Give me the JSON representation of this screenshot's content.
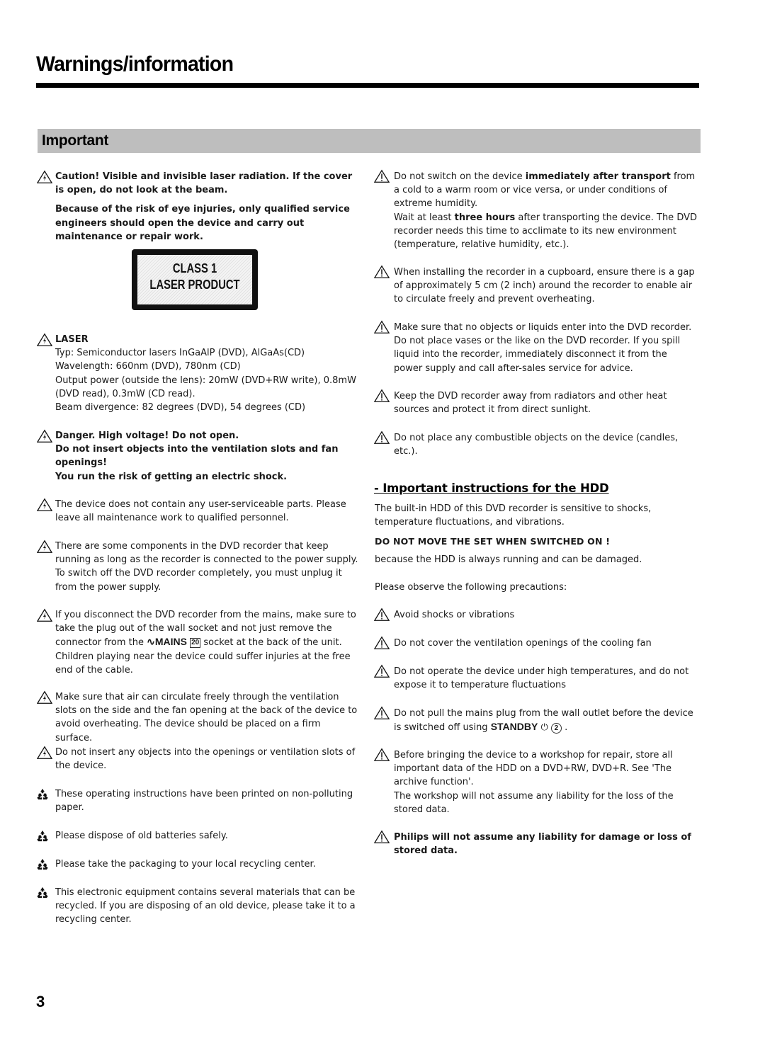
{
  "page": {
    "title": "Warnings/information",
    "section_title": "Important",
    "page_number": "3"
  },
  "left": {
    "caution": {
      "line1": "Caution! Visible and invisible laser radiation. If the cover is open, do not look at the beam.",
      "line2": "Because of the risk of eye injuries, only qualified service engineers should open the device and carry out maintenance or repair work."
    },
    "laser_label": {
      "line1": "CLASS 1",
      "line2": "LASER PRODUCT"
    },
    "laser": {
      "heading": "LASER",
      "lines": [
        "Typ: Semiconductor lasers InGaAlP (DVD), AlGaAs(CD)",
        "Wavelength: 660nm (DVD), 780nm (CD)",
        "Output power (outside the lens): 20mW (DVD+RW write), 0.8mW (DVD read), 0.3mW (CD read).",
        "Beam divergence: 82 degrees (DVD), 54 degrees (CD)"
      ]
    },
    "danger": {
      "line1": "Danger. High voltage! Do not open.",
      "line2": "Do not insert objects into the ventilation slots and fan openings!",
      "line3": "You run the risk of getting an electric shock."
    },
    "no_user_parts": "The device does not contain any user-serviceable parts. Please leave all maintenance work to qualified personnel.",
    "components_running": "There are some components in the DVD recorder that keep running as long as the recorder is connected to the power supply. To switch off the DVD recorder completely, you must unplug it from the power supply.",
    "disconnect": {
      "before": "If you disconnect the DVD recorder from the mains, make sure to take the plug out of the wall socket and not just remove the connector from the",
      "mains_symbol": "∿",
      "mains_label": "MAINS",
      "mains_number": "20",
      "after": "socket at the back of the unit. Children playing near the device could suffer injuries at the free end of the cable."
    },
    "air_circulate": "Make sure that air can circulate freely through the ventilation slots on the side and the fan opening at the back of the device to avoid overheating. The device should be placed on a firm surface.",
    "no_insert": "Do not insert any objects into the openings or ventilation slots of the device.",
    "recycle_items": [
      "These operating instructions have been printed on non-polluting paper.",
      "Please dispose of old batteries safely.",
      "Please take the packaging to your local recycling center.",
      "This electronic equipment contains several materials that can be recycled. If you are disposing of an old device, please take it to a recycling center."
    ]
  },
  "right": {
    "transport": {
      "pre": "Do not switch on the device ",
      "bold": "immediately after transport",
      "post": " from a cold to a warm room or vice versa, or under conditions of extreme humidity.",
      "wait_pre": "Wait at least ",
      "wait_bold": "three hours",
      "wait_post": " after transporting the device. The DVD recorder needs this time to acclimate to its new environment (temperature, relative humidity, etc.)."
    },
    "cupboard": "When installing the recorder in a cupboard, ensure there is a gap of approximately 5 cm (2 inch) around the recorder to enable air to circulate freely and prevent overheating.",
    "liquids": "Make sure that no objects or liquids enter into the DVD recorder. Do not place vases or the like on the DVD recorder. If you spill liquid into the recorder, immediately disconnect it from the power supply and call after-sales service for advice.",
    "radiators": "Keep the DVD recorder away from radiators and other heat sources and protect it from direct sunlight.",
    "combustible": "Do not place any combustible objects on the device (candles, etc.).",
    "hdd": {
      "heading": "- Important instructions for the HDD",
      "intro": "The built-in HDD of this DVD recorder is sensitive to shocks, temperature fluctuations, and vibrations.",
      "caps_warning": "DO NOT MOVE THE SET WHEN SWITCHED ON !",
      "because": "because the HDD is always running and can be damaged.",
      "observe": "Please observe the following precautions:",
      "shocks": "Avoid shocks or vibrations",
      "cover_fan": "Do not cover the ventilation openings of the cooling fan",
      "temperatures": "Do not operate the device under high temperatures, and do not expose it to temperature fluctuations",
      "mains_plug": {
        "before": "Do not pull the mains plug from the wall outlet before the device is switched off using",
        "standby_label": "STANDBY",
        "standby_symbol": "⏻",
        "standby_number": "2",
        "after": "."
      },
      "workshop": {
        "line1": "Before bringing the device to a workshop for repair, store all important data of the HDD on a DVD+RW, DVD+R. See 'The archive function'.",
        "line2": "The workshop will not assume any liability for the loss of the stored data."
      },
      "philips_liability": "Philips will not assume any liability for damage or loss of stored data."
    }
  }
}
